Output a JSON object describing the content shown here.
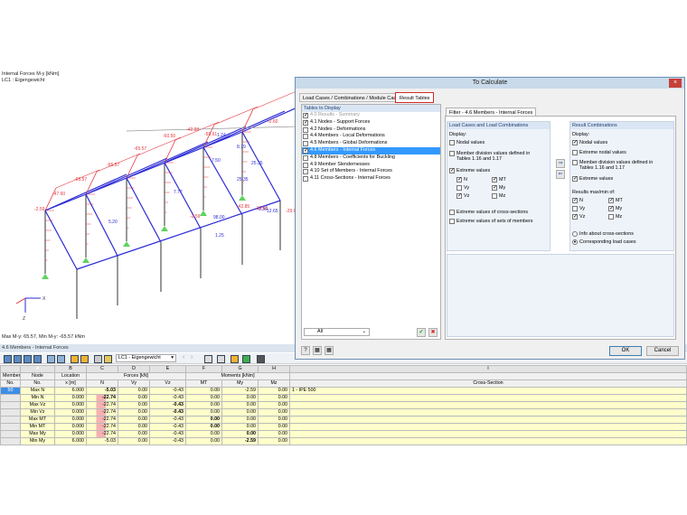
{
  "viewport": {
    "title_line1": "Internal Forces M-y [kNm]",
    "title_line2": "LC1 : Eigengewicht",
    "footer": "Max M-y: 65.57, Min M-y: -65.57 kNm",
    "axis_labels": {
      "x": "X",
      "z": "Z"
    },
    "labels": [
      "-2.59",
      "-47.60",
      "-65.57",
      "-65.57",
      "-65.57",
      "-60.50",
      "-42.68",
      "-2.60",
      "-59.61",
      "1.24",
      "8.79",
      "25.35",
      "25.35",
      "7.50",
      "7.77",
      "0.36",
      "1.25",
      "5.20",
      "-10.63",
      "-2.59",
      "-29.65",
      "12.65",
      "98.00",
      "-42.85"
    ],
    "colors": {
      "moment": "#e8333a",
      "member": "#2b2bd6",
      "support": "#5fd35f"
    }
  },
  "dialog": {
    "title": "To Calculate",
    "close": "×",
    "tabs": [
      {
        "label": "Load Cases / Combinations / Module Cases"
      },
      {
        "label": "Result Tables",
        "active": true
      }
    ],
    "tables_header": "Tables to Display",
    "tables": [
      {
        "label": "4.0 Results - Summary",
        "checked": true,
        "dim": true
      },
      {
        "label": "4.1 Nodes - Support Forces",
        "checked": true
      },
      {
        "label": "4.2 Nodes - Deformations",
        "checked": false
      },
      {
        "label": "4.4 Members - Local Deformations",
        "checked": false
      },
      {
        "label": "4.5 Members - Global Deformations",
        "checked": false
      },
      {
        "label": "4.6 Members - Internal Forces",
        "checked": true,
        "selected": true
      },
      {
        "label": "4.8 Members - Coefficients for Buckling",
        "checked": false
      },
      {
        "label": "4.9 Member Slendernesses",
        "checked": false
      },
      {
        "label": "4.10 Set of Members - Internal Forces",
        "checked": false
      },
      {
        "label": "4.11 Cross-Sections - Internal Forces",
        "checked": false
      }
    ],
    "filter_select": "All",
    "filter_tab": "Filter - 4.6 Members - Internal Forces",
    "lc": {
      "header": "Load Cases and Load Combinations",
      "display": "Display:",
      "nodal": "Nodal values",
      "division_1": "Member division values defined in",
      "division_2": "Tables 1.16 and 1.17",
      "extreme": "Extreme values",
      "N": "N",
      "Vy": "Vy",
      "Vz": "Vz",
      "MT": "MT",
      "My": "My",
      "Mz": "Mz",
      "extreme_cs": "Extreme values of cross-sections",
      "extreme_sets": "Extreme values of sets of members"
    },
    "rc": {
      "header": "Result Combinations",
      "display": "Display:",
      "nodal": "Nodal values",
      "extreme_nodal": "Extreme nodal values",
      "division_1": "Member division values defined in",
      "division_2": "Tables 1.16 and 1.17",
      "extreme": "Extreme values",
      "results_of": "Results max/min of:",
      "N": "N",
      "Vy": "Vy",
      "Vz": "Vz",
      "MT": "MT",
      "My": "My",
      "Mz": "Mz",
      "info_cs": "Info about cross-sections",
      "corr_lc": "Corresponding load cases"
    },
    "ok": "OK",
    "cancel": "Cancel"
  },
  "panel": {
    "title": "4.6 Members - Internal Forces",
    "loadcase": "LC1 - Eigengewicht"
  },
  "table": {
    "letters": [
      "A",
      "B",
      "C",
      "D",
      "E",
      "F",
      "G",
      "H",
      "I"
    ],
    "h1": {
      "member": "Member",
      "node": "Node",
      "location": "Location",
      "forces": "Forces [kN]",
      "moments": "Moments [kNm]"
    },
    "h2": {
      "member": "No.",
      "node": "No.",
      "location": "x [m]",
      "N": "N",
      "Vy": "Vy",
      "Vz": "Vz",
      "MT": "MT",
      "My": "My",
      "Mz": "Mz",
      "cs": "Cross-Section"
    },
    "member_no": "50",
    "cross_section": "1 - IPE 500",
    "rows": [
      {
        "node": "Max N",
        "x": "6.000",
        "N": "-5.03",
        "Vy": "0.00",
        "Vz": "-0.43",
        "MT": "0.00",
        "My": "-2.59",
        "Mz": "0.00"
      },
      {
        "node": "Min N",
        "x": "0.000",
        "N": "-22.74",
        "Vy": "0.00",
        "Vz": "-0.43",
        "MT": "0.00",
        "My": "0.00",
        "Mz": "0.00"
      },
      {
        "node": "Max Vz",
        "x": "0.000",
        "N": "-22.74",
        "Vy": "0.00",
        "Vz": "-0.43",
        "MT": "0.00",
        "My": "0.00",
        "Mz": "0.00"
      },
      {
        "node": "Min Vz",
        "x": "0.000",
        "N": "-22.74",
        "Vy": "0.00",
        "Vz": "-0.43",
        "MT": "0.00",
        "My": "0.00",
        "Mz": "0.00"
      },
      {
        "node": "Max MT",
        "x": "0.000",
        "N": "-22.74",
        "Vy": "0.00",
        "Vz": "-0.43",
        "MT": "0.00",
        "My": "0.00",
        "Mz": "0.00"
      },
      {
        "node": "Min MT",
        "x": "0.000",
        "N": "-22.74",
        "Vy": "0.00",
        "Vz": "-0.43",
        "MT": "0.00",
        "My": "0.00",
        "Mz": "0.00"
      },
      {
        "node": "Max My",
        "x": "0.000",
        "N": "-22.74",
        "Vy": "0.00",
        "Vz": "-0.43",
        "MT": "0.00",
        "My": "0.00",
        "Mz": "0.00"
      },
      {
        "node": "Min My",
        "x": "6.000",
        "N": "-5.03",
        "Vy": "0.00",
        "Vz": "-0.43",
        "MT": "0.00",
        "My": "-2.59",
        "Mz": "0.00"
      }
    ]
  }
}
